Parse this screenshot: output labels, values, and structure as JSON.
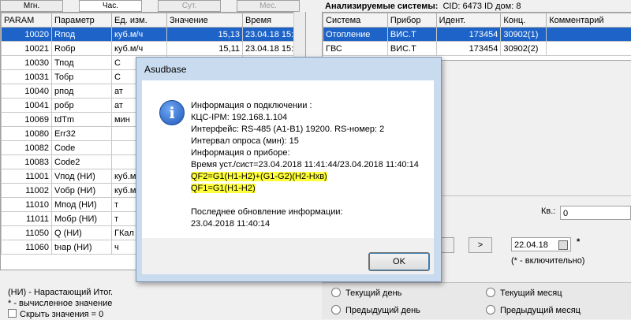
{
  "tabs": [
    {
      "label": "Мгн.",
      "state": "normal"
    },
    {
      "label": "Час.",
      "state": "active"
    },
    {
      "label": "Сут.",
      "state": "dim"
    },
    {
      "label": "Мес.",
      "state": "dim"
    }
  ],
  "params_table": {
    "headers": [
      "PARAM",
      "Параметр",
      "Ед. изм.",
      "Значение",
      "Время"
    ],
    "rows": [
      [
        "10020",
        "Rпод",
        "куб.м/ч",
        "15,13",
        "23.04.18 15:2"
      ],
      [
        "10021",
        "Rобр",
        "куб.м/ч",
        "15,11",
        "23.04.18 15:2"
      ],
      [
        "10030",
        "Тпод",
        "С",
        "",
        ""
      ],
      [
        "10031",
        "Тобр",
        "С",
        "",
        ""
      ],
      [
        "10040",
        "pпод",
        "ат",
        "",
        ""
      ],
      [
        "10041",
        "pобр",
        "ат",
        "",
        ""
      ],
      [
        "10069",
        "tdTm",
        "мин",
        "",
        ""
      ],
      [
        "10080",
        "Err32",
        "",
        "",
        ""
      ],
      [
        "10082",
        "Code",
        "",
        "",
        ""
      ],
      [
        "10083",
        "Code2",
        "",
        "",
        ""
      ],
      [
        "11001",
        "Vпод (НИ)",
        "куб.м",
        "",
        ""
      ],
      [
        "11002",
        "Vобр (НИ)",
        "куб.м",
        "",
        ""
      ],
      [
        "11010",
        "Мпод (НИ)",
        "т",
        "",
        ""
      ],
      [
        "11011",
        "Мобр (НИ)",
        "т",
        "",
        ""
      ],
      [
        "11050",
        "Q (НИ)",
        "ГКал",
        "",
        ""
      ],
      [
        "11060",
        "tнар (НИ)",
        "ч",
        "",
        ""
      ]
    ]
  },
  "legend": {
    "line1": "(НИ) - Нарастающий Итог.",
    "line2": "* - вычисленное значение",
    "line3": "Скрыть значения = 0"
  },
  "systems": {
    "title": "Анализируемые системы:",
    "cid": "CID: 6473 ID дом: 8",
    "headers": [
      "Система",
      "Прибор",
      "Идент.",
      "Конц.",
      "Комментарий"
    ],
    "rows": [
      [
        "Отопление",
        "ВИС.Т",
        "173454",
        "30902(1)",
        ""
      ],
      [
        "ГВС",
        "ВИС.Т",
        "173454",
        "30902(2)",
        ""
      ]
    ]
  },
  "kv": {
    "label": "Кв.:",
    "value": "0"
  },
  "date_nav": {
    "next": ">",
    "date": "22.04.18",
    "star": "*",
    "hint": "(* - включительно)"
  },
  "radios": {
    "today": "Текущий день",
    "prev_day": "Предыдущий день",
    "month": "Текущий месяц",
    "prev_month": "Предыдущий месяц"
  },
  "dialog": {
    "title": "Asudbase",
    "lines": [
      "Информация о подключении :",
      "КЦС-IPM: 192.168.1.104",
      "Интерфейс: RS-485 (A1-B1) 19200. RS-номер: 2",
      "Интервал опроса (мин): 15",
      "Информация о приборе:",
      "Время уст./сист=23.04.2018 11:41:44/23.04.2018 11:40:14"
    ],
    "qf2": "QF2=G1(H1-H2)+(G1-G2)(H2-Hхв)",
    "qf1": "QF1=G1(H1-H2)",
    "last_update_label": "Последнее обновление информации:",
    "last_update_value": "23.04.2018 11:40:14",
    "ok": "OK"
  }
}
